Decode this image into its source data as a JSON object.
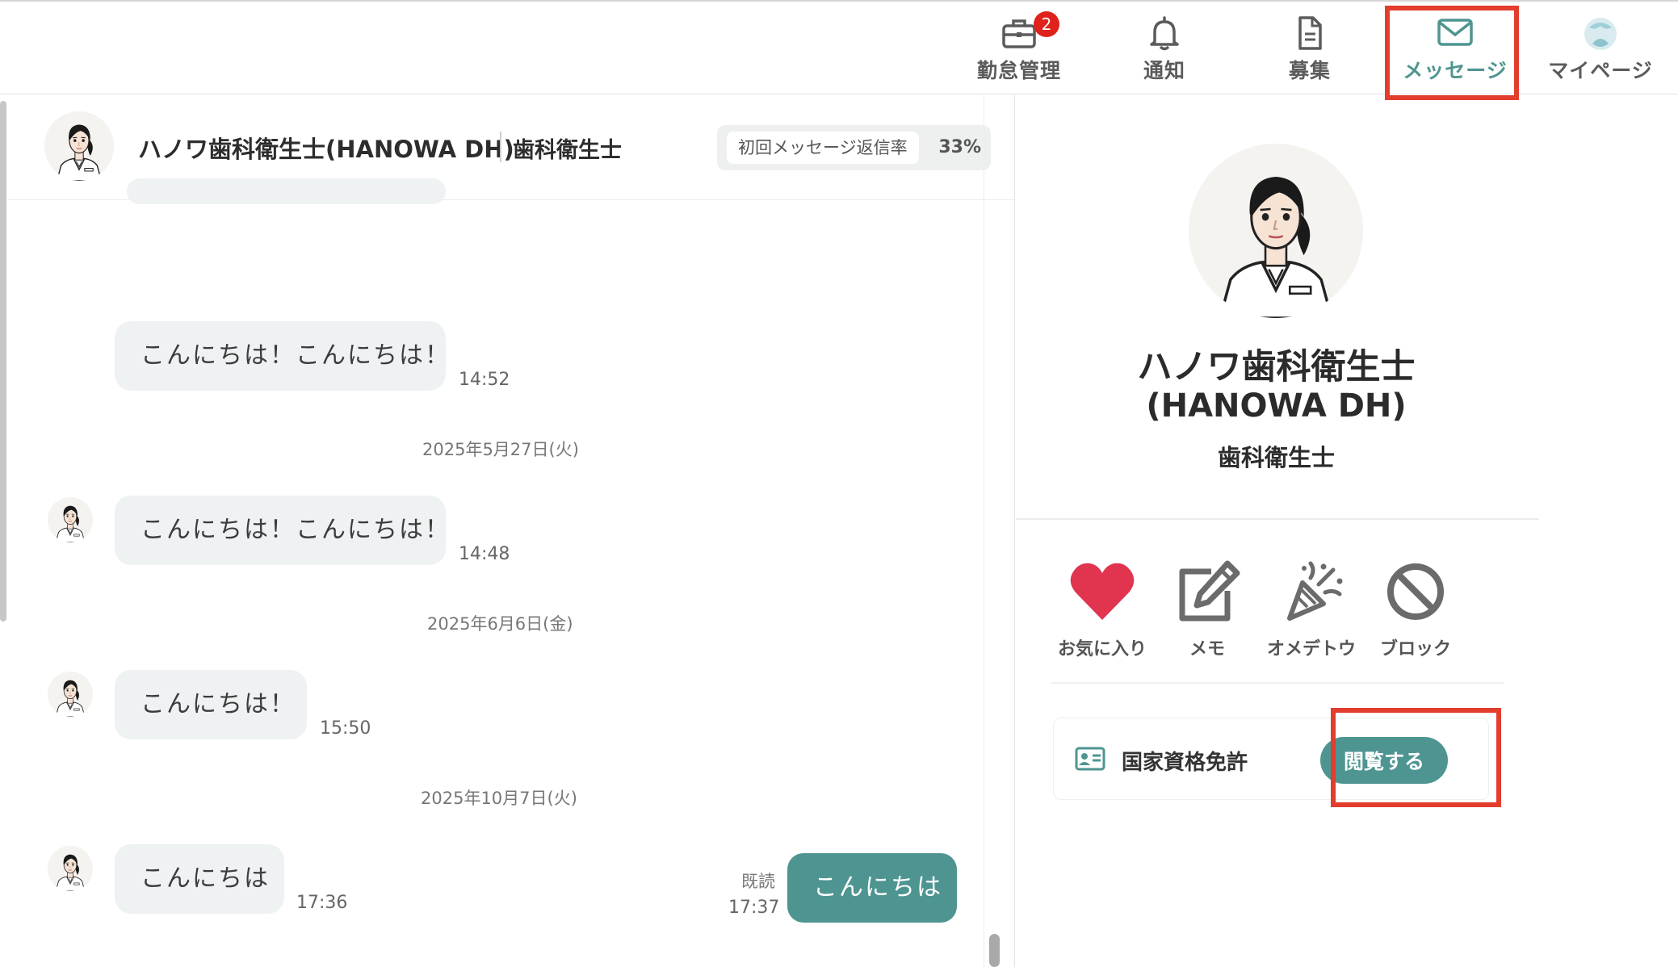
{
  "nav": {
    "items": [
      {
        "label": "勤怠管理",
        "icon": "briefcase-icon",
        "badge": "2"
      },
      {
        "label": "通知",
        "icon": "bell-icon"
      },
      {
        "label": "募集",
        "icon": "document-icon"
      },
      {
        "label": "メッセージ",
        "icon": "mail-icon",
        "active": true
      },
      {
        "label": "マイページ",
        "icon": "avatar-icon"
      }
    ]
  },
  "chat": {
    "header": {
      "name": "ハノワ歯科衛生士(HANOWA DH)",
      "role": "歯科衛生士",
      "reply_rate_label": "初回メッセージ返信率",
      "reply_rate_value": "33%"
    },
    "messages": [
      {
        "text": "こんにちは！こんにちは！",
        "time": "14:52"
      },
      {
        "date": "2025年5月27日(火)"
      },
      {
        "text": "こんにちは！こんにちは！",
        "time": "14:48"
      },
      {
        "date": "2025年6月6日(金)"
      },
      {
        "text": "こんにちは！",
        "time": "15:50"
      },
      {
        "date": "2025年10月7日(火)"
      },
      {
        "text": "こんにちは",
        "time": "17:36"
      },
      {
        "text": "こんにちは",
        "time": "17:37",
        "read": "既読"
      }
    ]
  },
  "profile": {
    "name_line1": "ハノワ歯科衛生士",
    "name_line2": "(HANOWA DH)",
    "role": "歯科衛生士",
    "actions": [
      {
        "label": "お気に入り",
        "icon": "heart-icon"
      },
      {
        "label": "メモ",
        "icon": "edit-icon"
      },
      {
        "label": "オメデトウ",
        "icon": "party-popper-icon"
      },
      {
        "label": "ブロック",
        "icon": "block-icon"
      }
    ],
    "license": {
      "label": "国家資格免許",
      "button": "閲覧する"
    }
  },
  "colors": {
    "accent": "#4e9591",
    "highlight": "#e33d2d",
    "heart": "#e0344f",
    "badge": "#e0221c",
    "bubble": "#eff2f3"
  }
}
